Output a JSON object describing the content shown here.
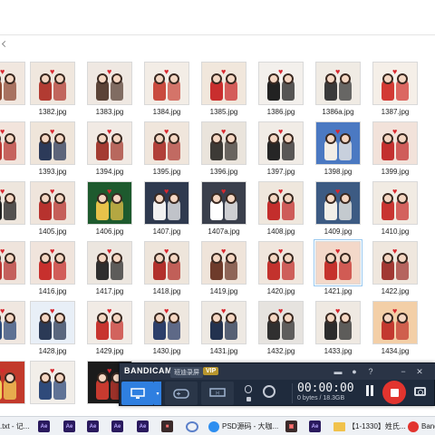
{
  "grid": {
    "rows": [
      {
        "cells": [
          {
            "name": "",
            "bg": "#f1e7df",
            "fg": "#8f4b35"
          },
          {
            "name": "1382.jpg",
            "bg": "#f0e7de",
            "fg": "#b23b32"
          },
          {
            "name": "1383.jpg",
            "bg": "#efe8e2",
            "fg": "#5b4337"
          },
          {
            "name": "1384.jpg",
            "bg": "#f3ede6",
            "fg": "#c94b3f"
          },
          {
            "name": "1385.jpg",
            "bg": "#f1e7dc",
            "fg": "#c92e2e"
          },
          {
            "name": "1386.jpg",
            "bg": "#f3f0ec",
            "fg": "#222222"
          },
          {
            "name": "1386a.jpg",
            "bg": "#f0ebe4",
            "fg": "#3a3a3a"
          },
          {
            "name": "1387.jpg",
            "bg": "#f5efe8",
            "fg": "#d23a34"
          }
        ]
      },
      {
        "cells": [
          {
            "name": "",
            "bg": "#f2e4dc",
            "fg": "#b73833"
          },
          {
            "name": "1393.jpg",
            "bg": "#efe5da",
            "fg": "#2c3a59"
          },
          {
            "name": "1394.jpg",
            "bg": "#f1eae4",
            "fg": "#a43c32"
          },
          {
            "name": "1395.jpg",
            "bg": "#f0e6dc",
            "fg": "#b14039"
          },
          {
            "name": "1396.jpg",
            "bg": "#eae4dc",
            "fg": "#3d3a36"
          },
          {
            "name": "1397.jpg",
            "bg": "#f1ece6",
            "fg": "#262626"
          },
          {
            "name": "1398.jpg",
            "bg": "#4b79c2",
            "fg": "#f2ede6"
          },
          {
            "name": "1399.jpg",
            "bg": "#f2e2da",
            "fg": "#c3302f"
          }
        ]
      },
      {
        "cells": [
          {
            "name": "",
            "bg": "#eee6dd",
            "fg": "#1f1f1f"
          },
          {
            "name": "1405.jpg",
            "bg": "#efe5dc",
            "fg": "#b7322e"
          },
          {
            "name": "1406.jpg",
            "bg": "#1e5a2e",
            "fg": "#e7c24a"
          },
          {
            "name": "1407.jpg",
            "bg": "#2f3a4f",
            "fg": "#f1f1f1"
          },
          {
            "name": "1407a.jpg",
            "bg": "#3a3f4c",
            "fg": "#ffffff"
          },
          {
            "name": "1408.jpg",
            "bg": "#efe7dd",
            "fg": "#c32e2c"
          },
          {
            "name": "1409.jpg",
            "bg": "#3d5b83",
            "fg": "#f2efe8"
          },
          {
            "name": "1410.jpg",
            "bg": "#f1ebe3",
            "fg": "#c83431"
          }
        ]
      },
      {
        "cells": [
          {
            "name": "",
            "bg": "#efe4dc",
            "fg": "#b63431"
          },
          {
            "name": "1416.jpg",
            "bg": "#f0e4dc",
            "fg": "#c7302d"
          },
          {
            "name": "1417.jpg",
            "bg": "#ece6df",
            "fg": "#2e2e2e"
          },
          {
            "name": "1418.jpg",
            "bg": "#eee5db",
            "fg": "#b2312c"
          },
          {
            "name": "1419.jpg",
            "bg": "#efe4da",
            "fg": "#6e3b2b"
          },
          {
            "name": "1420.jpg",
            "bg": "#f0e6dd",
            "fg": "#c3322d"
          },
          {
            "name": "1421.jpg",
            "bg": "#f3d8c9",
            "fg": "#c5322c"
          },
          {
            "name": "1422.jpg",
            "bg": "#efe7de",
            "fg": "#a13833"
          }
        ]
      },
      {
        "cells": [
          {
            "name": "",
            "bg": "#f0e7e0",
            "fg": "#2d4a7a"
          },
          {
            "name": "1428.jpg",
            "bg": "#e8eff7",
            "fg": "#2b3a56"
          },
          {
            "name": "1429.jpg",
            "bg": "#f1ebe5",
            "fg": "#c7352f"
          },
          {
            "name": "1430.jpg",
            "bg": "#eee7df",
            "fg": "#2d3f6a"
          },
          {
            "name": "1431.jpg",
            "bg": "#eee9e3",
            "fg": "#23324f"
          },
          {
            "name": "1432.jpg",
            "bg": "#e6e3df",
            "fg": "#303030"
          },
          {
            "name": "1433.jpg",
            "bg": "#efe9e2",
            "fg": "#2c2c2c"
          },
          {
            "name": "1434.jpg",
            "bg": "#f3cfa7",
            "fg": "#c3392f"
          }
        ]
      },
      {
        "cells": [
          {
            "name": "",
            "bg": "#c23a2b",
            "fg": "#f3d15a"
          },
          {
            "name": "",
            "bg": "#f2eee9",
            "fg": "#2f4a7a"
          },
          {
            "name": "",
            "bg": "#1b1b1b",
            "fg": "#c73a2f"
          }
        ]
      }
    ]
  },
  "bandicam": {
    "logo": "BANDICAM",
    "subtitle": "班迪录屏",
    "vip": "VIP",
    "timer": "00:00:00",
    "size": "0 bytes / 18.3GB",
    "accent": "#2f7fe0",
    "record_color": "#e2342e"
  },
  "taskbar": {
    "items": [
      {
        "label": ".txt - 记..."
      },
      {
        "label": "PSD源码 - 大咖..."
      },
      {
        "label": "【1-1330】姓氏..."
      },
      {
        "label": "Bandi"
      }
    ]
  }
}
